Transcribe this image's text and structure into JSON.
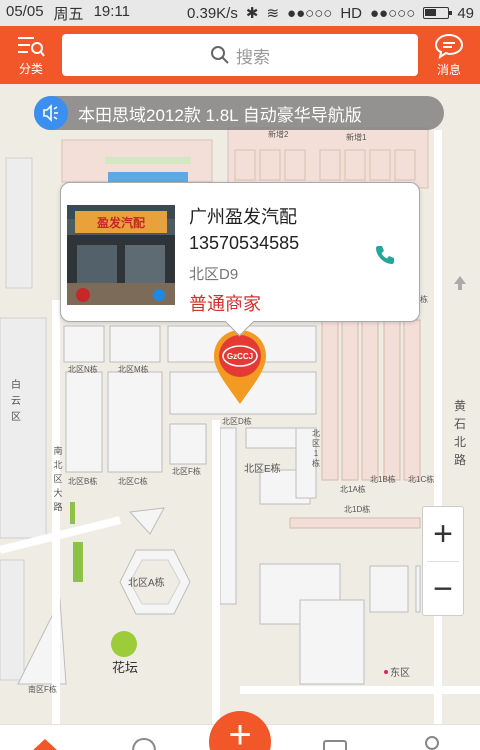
{
  "status_bar": {
    "date": "05/05",
    "weekday": "周五",
    "time": "19:11",
    "speed": "0.39K/s",
    "network": "HD",
    "battery": "49"
  },
  "header": {
    "category_label": "分类",
    "search_placeholder": "搜索",
    "message_label": "消息"
  },
  "notice": {
    "text": "本田思域2012款 1.8L 自动豪华导航版"
  },
  "shop_card": {
    "photo_sign": "盈发汽配",
    "name": "广州盈发汽配",
    "phone": "13570534585",
    "location": "北区D9",
    "merchant_type": "普通商家"
  },
  "map": {
    "marker_logo": "GzCCJ",
    "labels": {
      "xinzeng2": "新增2",
      "xinzeng1": "新增1",
      "north_n": "北区N栋",
      "north_m": "北区M栋",
      "north_d": "北区D栋",
      "north_e": "北区E栋",
      "north_f": "北区F栋",
      "north_b": "北区B栋",
      "north_c": "北区C栋",
      "north_g": "北区G栋",
      "north_1a": "北1A栋",
      "north_1b": "北1B栋",
      "north_1c": "北1C栋",
      "north_1d": "北1D栋",
      "north_a": "北区A栋",
      "north_1_vertical": "北区1栋",
      "south_f": "南区F栋",
      "east_zone": "东区",
      "flower_bed": "花坛",
      "qi": "栋",
      "baiyun_area": "白云区",
      "south_north_road": "南北区大路",
      "huangshi_north_road": "黄石北路"
    }
  },
  "zoom": {
    "plus": "+",
    "minus": "−"
  },
  "bottom_nav": {
    "center_plus": "+"
  }
}
